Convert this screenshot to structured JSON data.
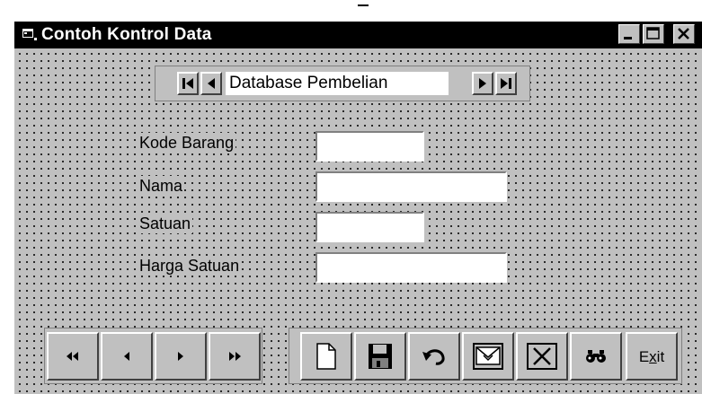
{
  "window": {
    "title": "Contoh Kontrol Data",
    "controls": {
      "minimize": "minimize-icon",
      "maximize": "maximize-icon",
      "close": "close-icon"
    }
  },
  "data_control": {
    "caption": "Database Pembelian",
    "buttons": [
      "move-first-icon",
      "move-previous-icon",
      "move-next-icon",
      "move-last-icon"
    ]
  },
  "fields": [
    {
      "label": "Kode Barang",
      "value": ""
    },
    {
      "label": "Nama",
      "value": ""
    },
    {
      "label": "Satuan",
      "value": ""
    },
    {
      "label": "Harga Satuan",
      "value": ""
    }
  ],
  "nav_buttons": [
    "first-record-icon",
    "previous-record-icon",
    "next-record-icon",
    "last-record-icon"
  ],
  "action_buttons": [
    "new-record-icon",
    "save-icon",
    "undo-icon",
    "update-icon",
    "delete-icon",
    "find-icon"
  ],
  "exit_button": {
    "label_pre": "E",
    "label_ul": "x",
    "label_post": "it"
  },
  "colors": {
    "titlebar": "#000000",
    "face": "#c0c0c0",
    "field": "#ffffff"
  }
}
